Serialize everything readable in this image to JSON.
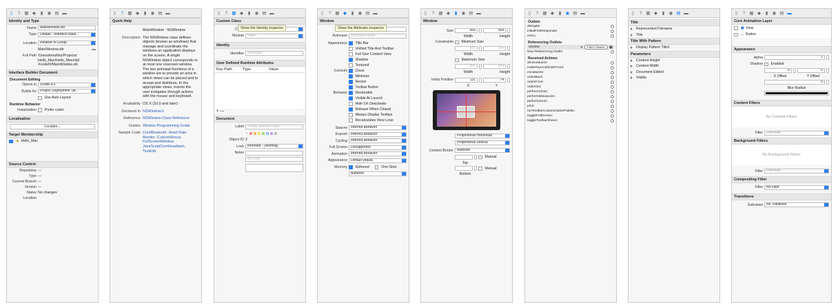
{
  "panels": {
    "p1": {
      "identity_title": "Identity and Type",
      "name_label": "Name",
      "name_value": "MainWindow.xib",
      "type_label": "Type",
      "type_value": "Default - Interface Build...",
      "location_label": "Location",
      "location_value": "Relative to Group",
      "location_file": "MainWindow.xib",
      "fullpath_label": "Full Path",
      "fullpath_value": "/Users/kmullins/Projects/ Hello_Mac/Hello_Mac/obj/ Xcode/0/MainWindow.xib",
      "ibd_title": "Interface Builder Document",
      "doc_editing": "Document Editing",
      "opens_in_label": "Opens in",
      "opens_in_value": "Xcode 4.6",
      "builds_for_label": "Builds for",
      "builds_for_value": "Project Deployment Tar...",
      "use_autolayout": "Use Auto Layout",
      "runtime_behavior": "Runtime Behavior",
      "instantiation_label": "Instantiation",
      "prefer_coder": "Prefer coder",
      "localization_title": "Localization",
      "localize_button": "Localize...",
      "target_title": "Target Membership",
      "target_item": "Hello_Mac",
      "source_title": "Source Control",
      "repository_label": "Repository",
      "repository_value": "—",
      "type2_label": "Type",
      "type2_value": "—",
      "branch_label": "Current Branch",
      "branch_value": "—",
      "version_label": "Version",
      "version_value": "—",
      "status_label": "Status",
      "status_value": "No changes",
      "location2_label": "Location"
    },
    "p2": {
      "title": "Quick Help",
      "header": "MainWindow : NSWindow",
      "desc_label": "Description",
      "desc_value": "The NSWindow class defines objects (known as windows) that manage and coordinate the windows an application displays on the screen. A single NSWindow object corresponds to at most one onscreen window. The two principal functions of a window are to provide an area in which views can be placed and to accept and distribute, to the appropriate views, events the user instigates through actions with the mouse and keyboard.",
      "avail_label": "Availability",
      "avail_value": "OS X (10.0 and later)",
      "declared_label": "Declared In",
      "declared_value": "NSWindow.h",
      "ref_label": "Reference",
      "ref_value": "NSWindow Class Reference",
      "guides_label": "Guides",
      "guides_value": "Window Programming Guide",
      "sample_label": "Sample Code",
      "sample_value": "CoreBluetooth: Heart Rate Monitor, CustomMenus, FullScreenWindow, JavaScriptCoreHeadstart, TextEdit"
    },
    "p3": {
      "custom_class": "Custom Class",
      "tooltip": "Show the Identity inspector",
      "class_label": "Class",
      "class_value": "MainWindow",
      "module_label": "Module",
      "module_value": "None",
      "identity_title": "Identity",
      "identifier_label": "Identifier",
      "identifier_ph": "Automatic",
      "udra_title": "User Defined Runtime Attributes",
      "col_keypath": "Key Path",
      "col_type": "Type",
      "col_value": "Value",
      "plusminus": "+ —",
      "document_title": "Document",
      "label_label": "Label",
      "label_ph": "Xcode Specific Label",
      "objectid_label": "Object ID",
      "objectid_value": "2",
      "lock_label": "Lock",
      "lock_value": "Inherited - (Nothing)",
      "notes_label": "Notes",
      "notes_ph": "No Font"
    },
    "p4": {
      "window_title": "Window",
      "tooltip": "Show the Attributes inspector",
      "title_label": "Title",
      "title_value": "Window",
      "autosave_label": "Autosave",
      "autosave_ph": "Autosave Name",
      "appearance_label": "Appearance",
      "appearance_items": [
        {
          "label": "Title Bar",
          "on": true
        },
        {
          "label": "Unified Title And Toolbar",
          "on": false
        },
        {
          "label": "Full Size Content View",
          "on": false
        },
        {
          "label": "Shadow",
          "on": true
        },
        {
          "label": "Textured",
          "on": false
        }
      ],
      "controls_label": "Controls",
      "controls_items": [
        {
          "label": "Close",
          "on": true
        },
        {
          "label": "Minimize",
          "on": true
        },
        {
          "label": "Resize",
          "on": true
        },
        {
          "label": "Toolbar Button",
          "on": true
        }
      ],
      "behavior_label": "Behavior",
      "behavior_items": [
        {
          "label": "Restorable",
          "on": true
        },
        {
          "label": "Visible At Launch",
          "on": true
        },
        {
          "label": "Hide On Deactivate",
          "on": false
        },
        {
          "label": "Release When Closed",
          "on": true
        },
        {
          "label": "Always Display Tooltips",
          "on": false
        },
        {
          "label": "Recalculates View Loop",
          "on": false
        }
      ],
      "spaces_label": "Spaces",
      "spaces_value": "Inferred Behavior",
      "expose_label": "Exposé",
      "expose_value": "Inferred Behavior",
      "cycling_label": "Cycling",
      "cycling_value": "Inferred Behavior",
      "fullscreen_label": "Full Screen",
      "fullscreen_value": "Unsupported",
      "animation_label": "Animation",
      "animation_value": "Inferred Behavior",
      "appearance2_label": "Appearance",
      "appearance2_value": "Default (Aqua)",
      "memory_label": "Memory",
      "deferred": "Deferred",
      "oneshot": "One Shot",
      "buffered_value": "Buffered"
    },
    "p5": {
      "window_title": "Window",
      "size_label": "Size",
      "size_w": "606",
      "size_h": "354",
      "width": "Width",
      "height": "Height",
      "constraints_label": "Constraints",
      "min_size": "Minimum Size",
      "min_w": "606",
      "min_h": "354",
      "max_size": "Maximum Size",
      "max_w": "606",
      "max_h": "354",
      "initpos_label": "Initial Position",
      "init_x": "131",
      "init_y": "74",
      "x_label": "X",
      "y_label": "Y",
      "prop_h": "Proportional Horizontal",
      "prop_v": "Proportional Vertical",
      "content_border_label": "Content Border",
      "content_border_value": "Autosize",
      "top_label": "Top",
      "bottom_label": "Bottom",
      "manual": "Manual"
    },
    "p6": {
      "outlets_title": "Outlets",
      "outlets": [
        "delegate",
        "initialFirstResponder",
        "menu"
      ],
      "ref_title": "Referencing Outlets",
      "ref_item": "window",
      "ref_target": "File's Owner",
      "new_ref": "New Referencing Outlet",
      "actions_title": "Received Actions",
      "actions": [
        "deminiaturize:",
        "makeKeyAndOrderFront:",
        "miniaturize:",
        "orderBack:",
        "orderFront:",
        "orderOut:",
        "performClose:",
        "performMiniaturize:",
        "performZoom:",
        "print:",
        "runToolbarCustomizationPalette:",
        "toggleFullScreen:",
        "toggleToolbarShown:"
      ]
    },
    "p7": {
      "title_section": "Title",
      "title_items": [
        "Represented Filename",
        "Title"
      ],
      "pattern_section": "Title With Pattern",
      "pattern_items": [
        "Display Pattern Title1"
      ],
      "params_section": "Parameters",
      "params_items": [
        "Content Height",
        "Content Width",
        "Document Edited",
        "Visible"
      ]
    },
    "p8": {
      "core_anim": "Core Animation Layer",
      "layer_items": [
        "View",
        "Button"
      ],
      "appearance_title": "Appearance",
      "alpha_label": "Alpha",
      "alpha_value": "1",
      "shadow_label": "Shadow",
      "enabled": "Enabled",
      "shadow_x": "0",
      "shadow_y": "0",
      "x_offset": "X Offset",
      "y_offset": "Y Offset",
      "blur_value": "0",
      "blur_label": "Blur Radius",
      "content_filters": "Content Filters",
      "no_content": "No Content Filters",
      "filter_label": "Filter",
      "filter_unknown": "Unknown",
      "background_filters": "Background Filters",
      "no_background": "No Background Filters",
      "filter2_unknown": "Unknown",
      "compositing_title": "Compositing Filter",
      "no_filter": "No Filter",
      "transitions_title": "Transitions",
      "subviews_label": "Subviews",
      "no_transition": "No Transition"
    }
  },
  "colors": {
    "accent": "#2d7ef0",
    "active_icon": "#1c7ef0"
  }
}
